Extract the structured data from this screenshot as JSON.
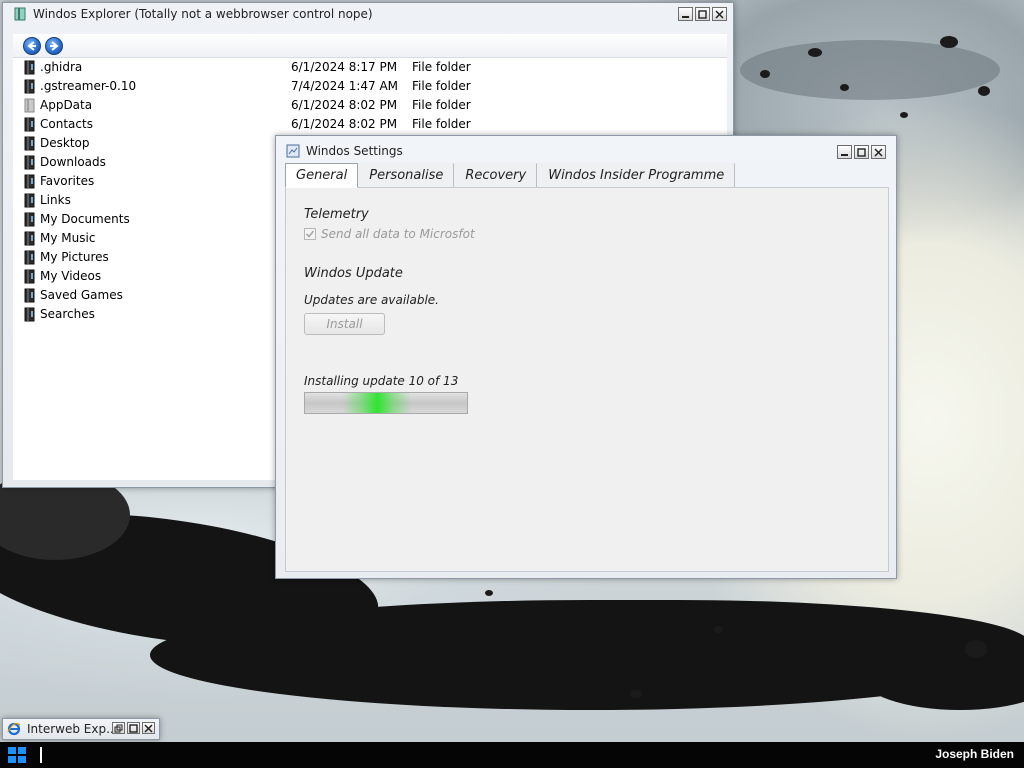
{
  "explorer": {
    "title": "Windos Explorer (Totally not a webbrowser control nope)",
    "nav_back": "back-arrow-icon",
    "nav_forward": "forward-arrow-icon",
    "files": [
      {
        "name": ".ghidra",
        "date": "6/1/2024 8:17 PM",
        "type": "File folder",
        "icon": "folder-dark-icon"
      },
      {
        "name": ".gstreamer-0.10",
        "date": "7/4/2024 1:47 AM",
        "type": "File folder",
        "icon": "folder-dark-icon"
      },
      {
        "name": "AppData",
        "date": "6/1/2024 8:02 PM",
        "type": "File folder",
        "icon": "folder-light-icon"
      },
      {
        "name": "Contacts",
        "date": "6/1/2024 8:02 PM",
        "type": "File folder",
        "icon": "contacts-folder-icon"
      },
      {
        "name": "Desktop",
        "date": "",
        "type": "",
        "icon": "desktop-folder-icon"
      },
      {
        "name": "Downloads",
        "date": "",
        "type": "",
        "icon": "downloads-folder-icon"
      },
      {
        "name": "Favorites",
        "date": "",
        "type": "",
        "icon": "favorites-folder-icon"
      },
      {
        "name": "Links",
        "date": "",
        "type": "",
        "icon": "links-folder-icon"
      },
      {
        "name": "My Documents",
        "date": "",
        "type": "",
        "icon": "documents-folder-icon"
      },
      {
        "name": "My Music",
        "date": "",
        "type": "",
        "icon": "music-folder-icon"
      },
      {
        "name": "My Pictures",
        "date": "",
        "type": "",
        "icon": "pictures-folder-icon"
      },
      {
        "name": "My Videos",
        "date": "",
        "type": "",
        "icon": "videos-folder-icon"
      },
      {
        "name": "Saved Games",
        "date": "",
        "type": "",
        "icon": "saved-games-folder-icon"
      },
      {
        "name": "Searches",
        "date": "",
        "type": "",
        "icon": "searches-folder-icon"
      }
    ]
  },
  "settings": {
    "title": "Windos Settings",
    "tabs": [
      "General",
      "Personalise",
      "Recovery",
      "Windos Insider Programme"
    ],
    "active_tab": "General",
    "telemetry_heading": "Telemetry",
    "telemetry_checkbox_label": "Send all data to Microsfot",
    "telemetry_checked": true,
    "update_heading": "Windos Update",
    "update_status": "Updates are available.",
    "install_label": "Install",
    "progress_label": "Installing update 10 of 13",
    "progress_fraction": 0.77
  },
  "ie_minimized": {
    "title": "Interweb Exp..."
  },
  "taskbar": {
    "user_name": "Joseph Biden"
  },
  "colors": {
    "taskbar": "#050505",
    "progress_green": "#28e628",
    "start_blue": "#1e90ff"
  }
}
